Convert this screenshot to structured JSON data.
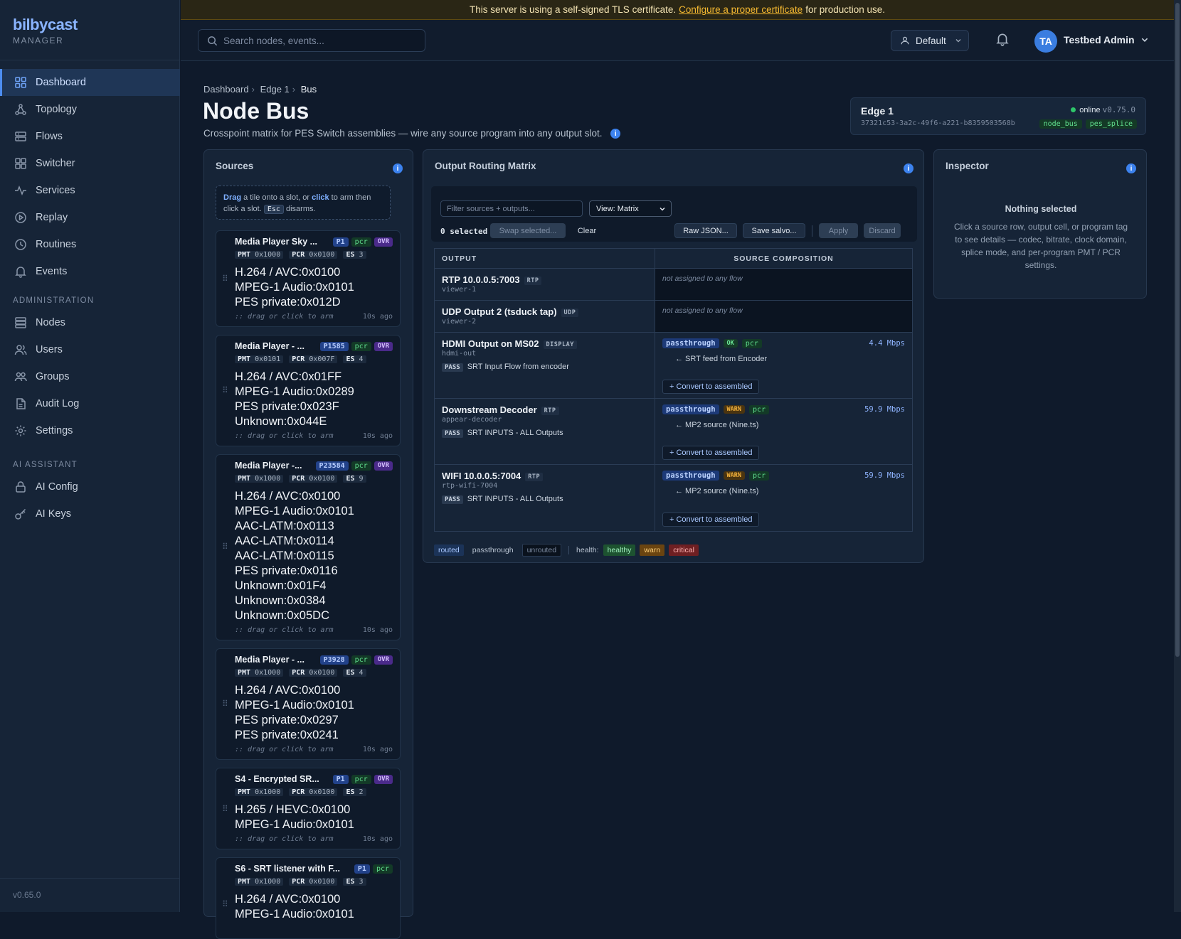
{
  "brand": {
    "title": "bilbycast",
    "subtitle": "MANAGER"
  },
  "nav": {
    "main": [
      {
        "label": "Dashboard",
        "icon": "grid-icon",
        "active": true
      },
      {
        "label": "Topology",
        "icon": "topology-icon"
      },
      {
        "label": "Flows",
        "icon": "flows-icon"
      },
      {
        "label": "Switcher",
        "icon": "switcher-icon"
      },
      {
        "label": "Services",
        "icon": "activity-icon"
      },
      {
        "label": "Replay",
        "icon": "play-circle-icon"
      },
      {
        "label": "Routines",
        "icon": "clock-icon"
      },
      {
        "label": "Events",
        "icon": "bell-icon"
      }
    ],
    "admin_heading": "ADMINISTRATION",
    "admin": [
      {
        "label": "Nodes",
        "icon": "server-icon"
      },
      {
        "label": "Users",
        "icon": "users-icon"
      },
      {
        "label": "Groups",
        "icon": "groups-icon"
      },
      {
        "label": "Audit Log",
        "icon": "document-icon"
      },
      {
        "label": "Settings",
        "icon": "gear-icon"
      }
    ],
    "ai_heading": "AI ASSISTANT",
    "ai": [
      {
        "label": "AI Config",
        "icon": "lock-icon"
      },
      {
        "label": "AI Keys",
        "icon": "key-icon"
      }
    ],
    "version": "v0.65.0"
  },
  "banner": {
    "prefix": "This server is using a self-signed TLS certificate.",
    "link": "Configure a proper certificate",
    "suffix": "for production use."
  },
  "topbar": {
    "search_placeholder": "Search nodes, events...",
    "workspace": "Default",
    "avatar_initials": "TA",
    "user_name": "Testbed Admin"
  },
  "breadcrumb": [
    "Dashboard",
    "Edge 1",
    "Bus"
  ],
  "page": {
    "title": "Node Bus",
    "subtitle": "Crosspoint matrix for PES Switch assemblies — wire any source program into any output slot."
  },
  "node": {
    "name": "Edge 1",
    "id": "37321c53-3a2c-49f6-a221-b8359503568b",
    "status": "online",
    "version": "v0.75.0",
    "tags": [
      "node_bus",
      "pes_splice"
    ]
  },
  "sources": {
    "title": "Sources",
    "hint": {
      "drag": "Drag",
      "mid1": "a tile onto a slot, or",
      "click": "click",
      "mid2": "to arm then click a slot.",
      "key": "Esc",
      "end": "disarms."
    },
    "footer_hint": ":: drag or click to arm",
    "items": [
      {
        "name": "Media Player Sky ...",
        "program": "P1",
        "pcr": "pcr",
        "ovr": "OVR",
        "pmt": "0x1000",
        "pcr_pid": "0x0100",
        "es": "3",
        "streams": [
          "H.264 / AVC:0x0100",
          "MPEG-1 Audio:0x0101",
          "PES private:0x012D"
        ],
        "age": "10s ago"
      },
      {
        "name": "Media Player - ...",
        "program": "P1585",
        "pcr": "pcr",
        "ovr": "OVR",
        "pmt": "0x0101",
        "pcr_pid": "0x007F",
        "es": "4",
        "streams": [
          "H.264 / AVC:0x01FF",
          "MPEG-1 Audio:0x0289",
          "PES private:0x023F",
          "Unknown:0x044E"
        ],
        "age": "10s ago"
      },
      {
        "name": "Media Player -...",
        "program": "P23584",
        "pcr": "pcr",
        "ovr": "OVR",
        "pmt": "0x1000",
        "pcr_pid": "0x0100",
        "es": "9",
        "streams": [
          "H.264 / AVC:0x0100",
          "MPEG-1 Audio:0x0101",
          "AAC-LATM:0x0113",
          "AAC-LATM:0x0114",
          "AAC-LATM:0x0115",
          "PES private:0x0116",
          "Unknown:0x01F4",
          "Unknown:0x0384",
          "Unknown:0x05DC"
        ],
        "age": "10s ago"
      },
      {
        "name": "Media Player - ...",
        "program": "P3928",
        "pcr": "pcr",
        "ovr": "OVR",
        "pmt": "0x1000",
        "pcr_pid": "0x0100",
        "es": "4",
        "streams": [
          "H.264 / AVC:0x0100",
          "MPEG-1 Audio:0x0101",
          "PES private:0x0297",
          "PES private:0x0241"
        ],
        "age": "10s ago"
      },
      {
        "name": "S4 - Encrypted SR...",
        "program": "P1",
        "pcr": "pcr",
        "ovr": "OVR",
        "pmt": "0x1000",
        "pcr_pid": "0x0100",
        "es": "2",
        "streams": [
          "H.265 / HEVC:0x0100",
          "MPEG-1 Audio:0x0101"
        ],
        "age": "10s ago"
      },
      {
        "name": "S6 - SRT listener with F...",
        "program": "P1",
        "pcr": "pcr",
        "ovr": "",
        "pmt": "0x1000",
        "pcr_pid": "0x0100",
        "es": "3",
        "streams": [
          "H.264 / AVC:0x0100",
          "MPEG-1 Audio:0x0101"
        ],
        "age": ""
      }
    ]
  },
  "matrix": {
    "title": "Output Routing Matrix",
    "filter_placeholder": "Filter sources + outputs...",
    "view": "View: Matrix",
    "selected": "0 selected",
    "buttons": {
      "swap": "Swap selected...",
      "clear": "Clear",
      "raw": "Raw JSON...",
      "salvo": "Save salvo...",
      "apply": "Apply",
      "discard": "Discard"
    },
    "headers": {
      "output": "OUTPUT",
      "composition": "SOURCE COMPOSITION"
    },
    "rows": [
      {
        "name": "RTP 10.0.0.5:7003",
        "type": "RTP",
        "id": "viewer-1",
        "unassigned": "not assigned to any flow"
      },
      {
        "name": "UDP Output 2 (tsduck tap)",
        "type": "UDP",
        "id": "viewer-2",
        "unassigned": "not assigned to any flow"
      },
      {
        "name": "HDMI Output on MS02",
        "type": "DISPLAY",
        "id": "hdmi-out",
        "pass": "PASS",
        "flow": "SRT Input Flow from encoder",
        "mode": "passthrough",
        "health": "OK",
        "pcr": "pcr",
        "rate": "4.4 Mbps",
        "feed": "← SRT feed from Encoder",
        "convert": "+ Convert to assembled"
      },
      {
        "name": "Downstream Decoder",
        "type": "RTP",
        "id": "appear-decoder",
        "pass": "PASS",
        "flow": "SRT INPUTS - ALL Outputs",
        "mode": "passthrough",
        "health": "WARN",
        "pcr": "pcr",
        "rate": "59.9 Mbps",
        "feed": "← MP2 source (Nine.ts)",
        "convert": "+ Convert to assembled"
      },
      {
        "name": "WIFI 10.0.0.5:7004",
        "type": "RTP",
        "id": "rtp-wifi-7004",
        "pass": "PASS",
        "flow": "SRT INPUTS - ALL Outputs",
        "mode": "passthrough",
        "health": "WARN",
        "pcr": "pcr",
        "rate": "59.9 Mbps",
        "feed": "← MP2 source (Nine.ts)",
        "convert": "+ Convert to assembled"
      }
    ],
    "legend": {
      "routed": "routed",
      "passthrough": "passthrough",
      "unrouted": "unrouted",
      "health_label": "health:",
      "healthy": "healthy",
      "warn": "warn",
      "critical": "critical"
    }
  },
  "inspector": {
    "title": "Inspector",
    "empty_title": "Nothing selected",
    "empty_desc": "Click a source row, output cell, or program tag to see details — codec, bitrate, clock domain, splice mode, and per-program PMT / PCR settings."
  },
  "colors": {
    "accent": "#3c82ee",
    "online": "#2ec66a",
    "warn": "#f2b13c",
    "critical": "#e25555",
    "healthy": "#6be596"
  }
}
